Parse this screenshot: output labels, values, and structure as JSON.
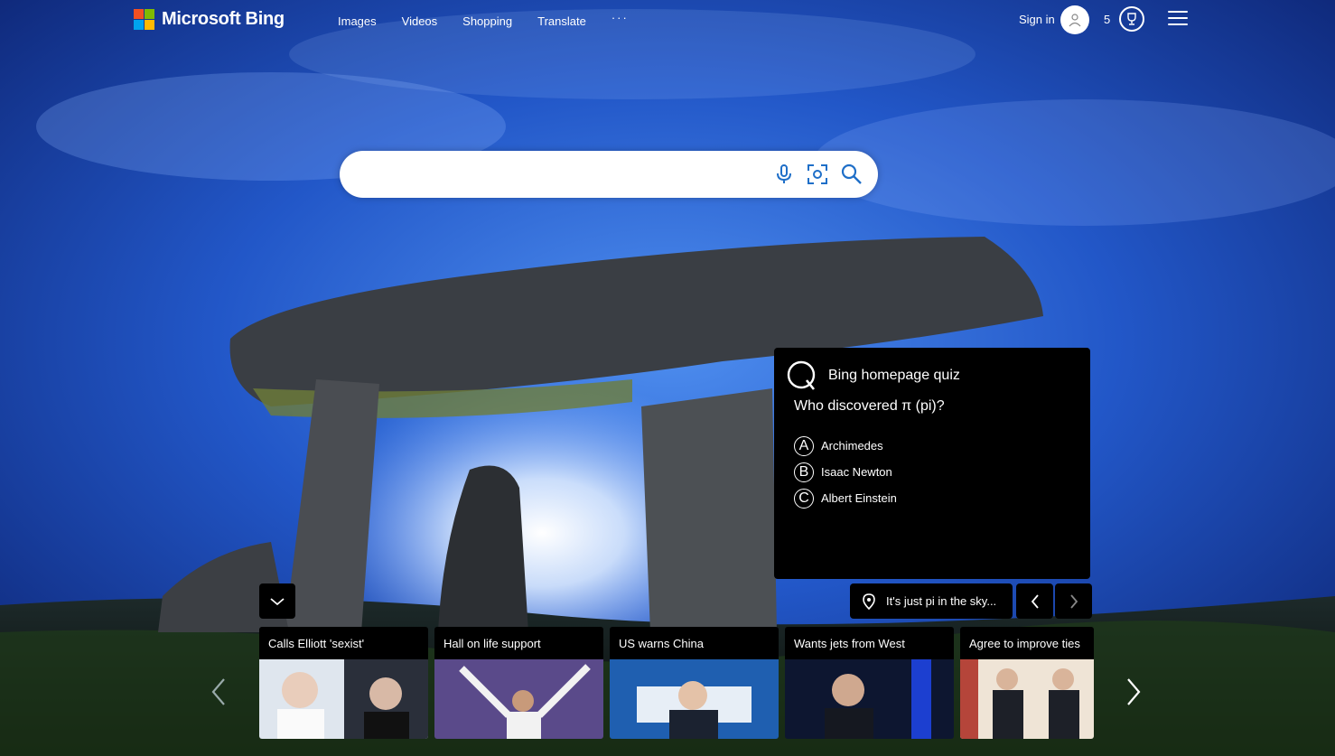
{
  "header": {
    "brand": "Microsoft Bing",
    "brand_colors": [
      "#f25022",
      "#7fba00",
      "#00a4ef",
      "#ffb900"
    ],
    "nav": [
      "Images",
      "Videos",
      "Shopping",
      "Translate"
    ],
    "more_label": "···",
    "sign_in": "Sign in",
    "points": "5"
  },
  "search": {
    "value": "",
    "icons": [
      "microphone-icon",
      "visual-search-icon",
      "search-icon"
    ]
  },
  "quiz": {
    "title": "Bing homepage quiz",
    "question": "Who discovered π (pi)?",
    "options": [
      {
        "letter": "A",
        "label": "Archimedes"
      },
      {
        "letter": "B",
        "label": "Isaac Newton"
      },
      {
        "letter": "C",
        "label": "Albert Einstein"
      }
    ]
  },
  "image_caption": "It's just pi in the sky...",
  "news": [
    {
      "title": "Calls Elliott 'sexist'"
    },
    {
      "title": "Hall on life support"
    },
    {
      "title": "US warns China"
    },
    {
      "title": "Wants jets from West"
    },
    {
      "title": "Agree to improve ties"
    }
  ]
}
